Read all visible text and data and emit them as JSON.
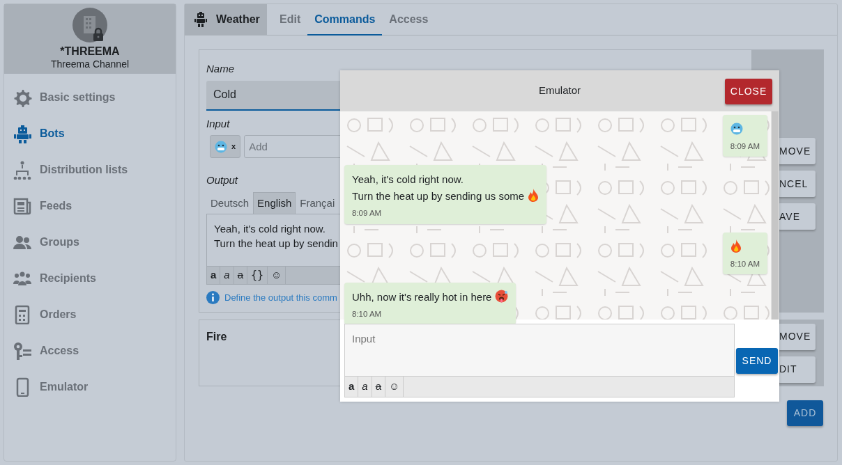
{
  "sidebar": {
    "title": "*THREEMA",
    "subtitle": "Threema Channel",
    "items": [
      {
        "label": "Basic settings",
        "selected": false
      },
      {
        "label": "Bots",
        "selected": true
      },
      {
        "label": "Distribution lists",
        "selected": false
      },
      {
        "label": "Feeds",
        "selected": false
      },
      {
        "label": "Groups",
        "selected": false
      },
      {
        "label": "Recipients",
        "selected": false
      },
      {
        "label": "Orders",
        "selected": false
      },
      {
        "label": "Access",
        "selected": false
      },
      {
        "label": "Emulator",
        "selected": false
      }
    ]
  },
  "header": {
    "bot_name": "Weather",
    "tabs": [
      {
        "label": "Edit",
        "selected": false
      },
      {
        "label": "Commands",
        "selected": true
      },
      {
        "label": "Access",
        "selected": false
      }
    ]
  },
  "commands": [
    {
      "kind": "editing",
      "name_label": "Name",
      "name_value": "Cold",
      "input_label": "Input",
      "chips": [
        {
          "kind": "cold-face",
          "remove": "x"
        }
      ],
      "input_placeholder": "Add",
      "output_label": "Output",
      "languages": [
        {
          "label": "Deutsch",
          "selected": false
        },
        {
          "label": "English",
          "selected": true
        },
        {
          "label": "Françai",
          "selected": false
        }
      ],
      "output_text": "Yeah, it's cold right now.\nTurn the heat up by sendin",
      "toolbar": [
        {
          "kind": "bold",
          "label": "a"
        },
        {
          "kind": "italic",
          "label": "a"
        },
        {
          "kind": "strike",
          "label": "a"
        },
        {
          "kind": "code",
          "label": "{}"
        },
        {
          "kind": "emoji",
          "label": "☺"
        }
      ],
      "hint": "Define the output this comm",
      "buttons": [
        "MOVE",
        "NCEL",
        "AVE"
      ]
    },
    {
      "kind": "collapsed",
      "name": "Fire",
      "buttons": [
        "MOVE",
        "DIT"
      ]
    }
  ],
  "add_button": "ADD",
  "emulator": {
    "title": "Emulator",
    "close": "CLOSE",
    "messages": [
      {
        "kind": "outgoing",
        "emoji": {
          "kind": "cold-face"
        },
        "time": "8:09 AM"
      },
      {
        "kind": "incoming",
        "text": "Yeah, it's cold right now.\nTurn the heat up by sending us some",
        "emoji": {
          "kind": "fire"
        },
        "time": "8:09 AM"
      },
      {
        "kind": "outgoing",
        "emoji": {
          "kind": "fire"
        },
        "time": "8:10 AM"
      },
      {
        "kind": "incoming",
        "text": "Uhh, now it's really hot in here",
        "emoji": {
          "kind": "hot-face"
        },
        "time": "8:10 AM"
      }
    ],
    "input_placeholder": "Input",
    "toolbar": [
      {
        "kind": "bold",
        "label": "a"
      },
      {
        "kind": "italic",
        "label": "a"
      },
      {
        "kind": "strike",
        "label": "a"
      },
      {
        "kind": "emoji",
        "label": "☺"
      }
    ],
    "send": "SEND"
  }
}
